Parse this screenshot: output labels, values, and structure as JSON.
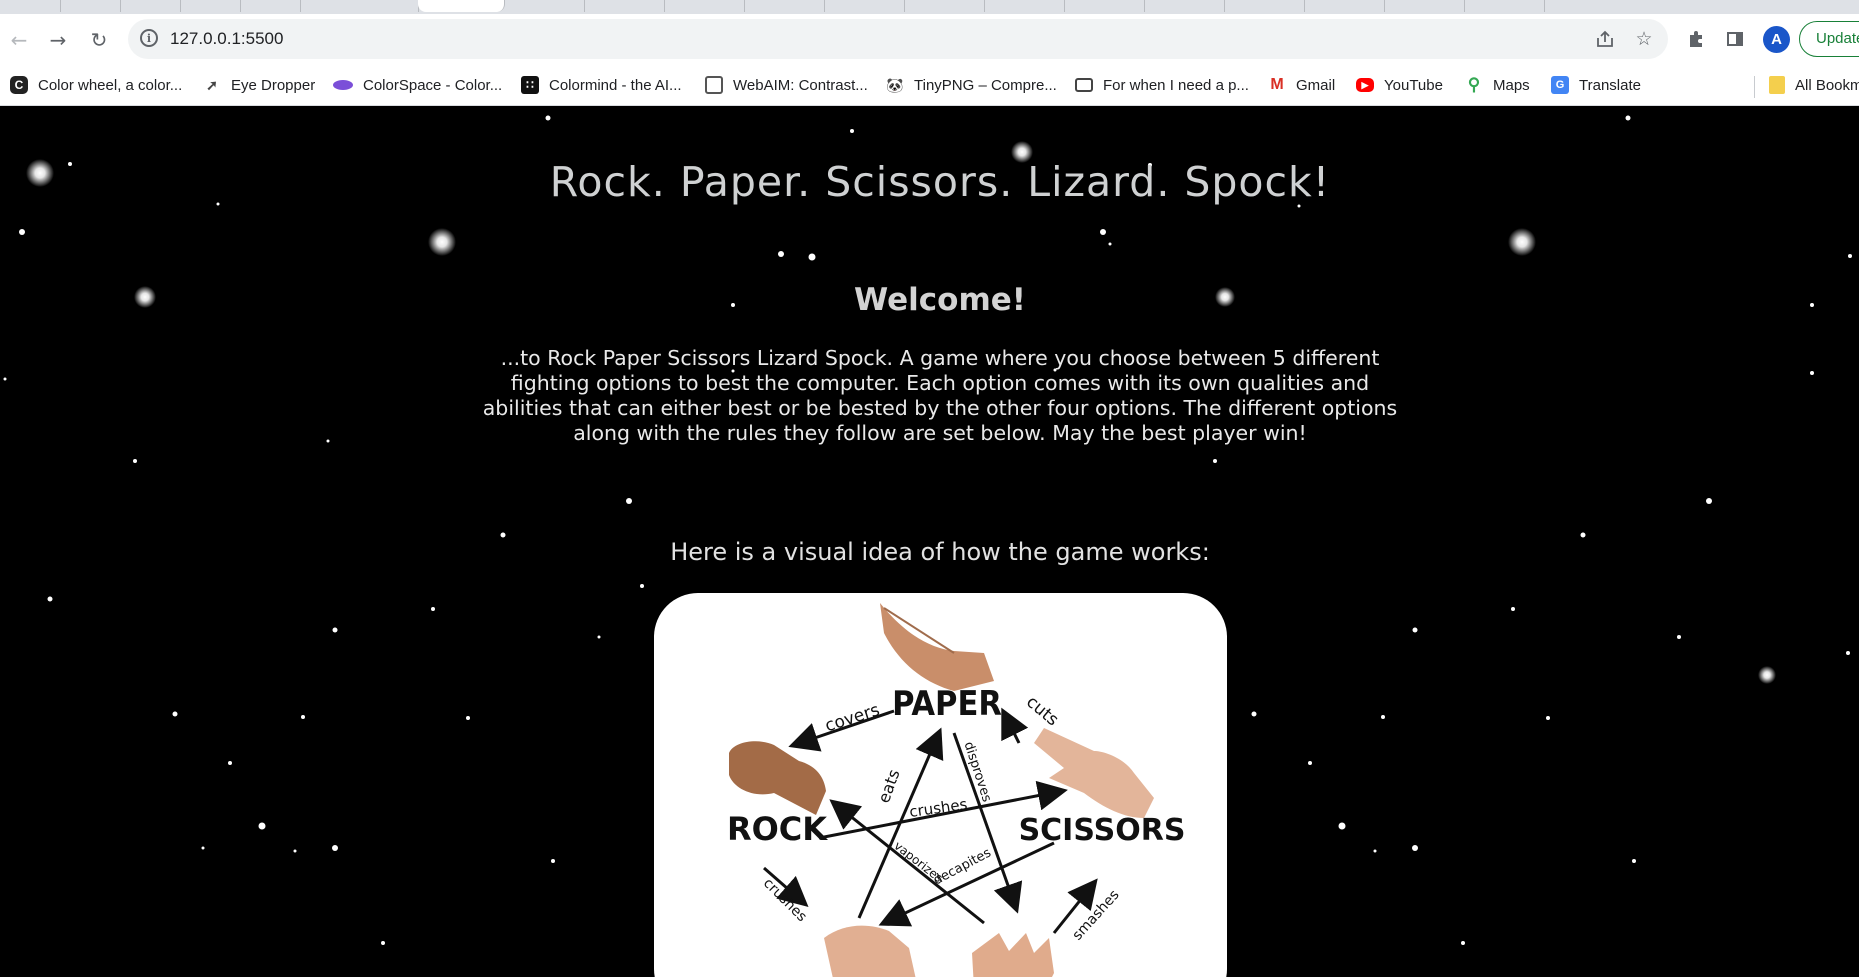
{
  "browser": {
    "url": "127.0.0.1:5500",
    "profile_initial": "A",
    "update_label": "Update",
    "bookmarks": [
      {
        "label": "Color wheel, a color...",
        "icon": "color-wheel-icon"
      },
      {
        "label": "Eye Dropper",
        "icon": "eye-dropper-icon"
      },
      {
        "label": "ColorSpace - Color...",
        "icon": "colorspace-icon"
      },
      {
        "label": "Colormind - the AI...",
        "icon": "colormind-icon"
      },
      {
        "label": "WebAIM: Contrast...",
        "icon": "webaim-icon"
      },
      {
        "label": "TinyPNG – Compre...",
        "icon": "tinypng-icon"
      },
      {
        "label": "For when I need a p...",
        "icon": "image-icon"
      },
      {
        "label": "Gmail",
        "icon": "gmail-icon"
      },
      {
        "label": "YouTube",
        "icon": "youtube-icon"
      },
      {
        "label": "Maps",
        "icon": "maps-icon"
      },
      {
        "label": "Translate",
        "icon": "translate-icon"
      }
    ],
    "all_bookmarks_label": "All Bookmarks"
  },
  "page": {
    "title": "Rock. Paper. Scissors. Lizard. Spock!",
    "welcome": "Welcome!",
    "intro": "...to Rock Paper Scissors Lizard Spock. A game where you choose between 5 different fighting options to best the computer. Each option comes with its own qualities and abilities that can either best or be bested by the other four options. The different options along with the rules they follow are set below. May the best player win!",
    "visual_heading": "Here is a visual idea of how the game works:",
    "diagram": {
      "paper": "PAPER",
      "rock": "ROCK",
      "scissors": "SCISSORS",
      "covers": "covers",
      "cuts": "cuts",
      "eats": "eats",
      "disproves": "disproves",
      "crushes_top": "crushes",
      "vaporizes": "vaporizes",
      "decapites": "decapites",
      "crushes_bottom": "crushes",
      "smashes": "smashes"
    }
  },
  "colors": {
    "background": "#000000",
    "heading": "#cfd1d2",
    "text": "#e9e9e9",
    "update_green": "#188038",
    "avatar_blue": "#1a56c9"
  }
}
